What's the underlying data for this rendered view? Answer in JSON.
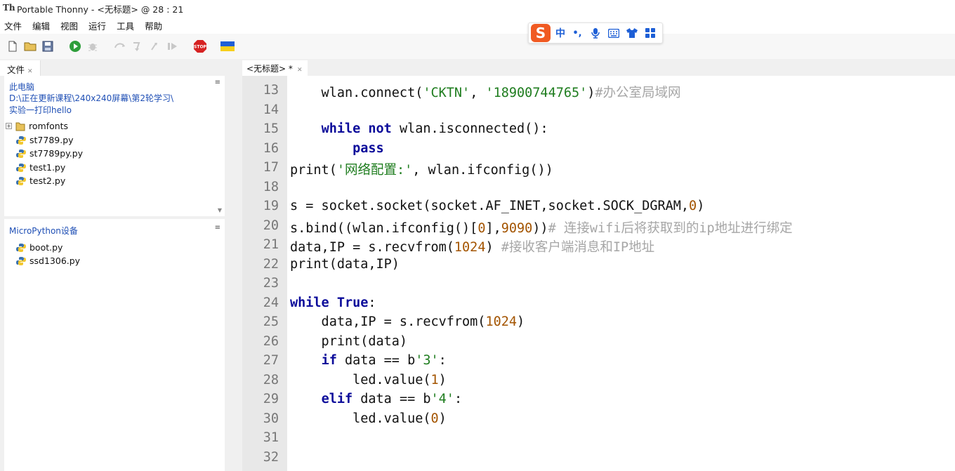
{
  "window": {
    "title": "Portable Thonny  -  <无标题>  @  28 : 21"
  },
  "menu": [
    "文件",
    "编辑",
    "视图",
    "运行",
    "工具",
    "帮助"
  ],
  "ime": {
    "logo": "S",
    "lang": "中",
    "punct": "•,"
  },
  "files_pane": {
    "tab_label": "文件",
    "location_label": "此电脑",
    "path_lines": [
      "D:\\正在更新课程\\240x240屏幕\\第2轮学习\\",
      "实验一打印hello"
    ],
    "folders": [
      "romfonts"
    ],
    "files": [
      "st7789.py",
      "st7789py.py",
      "test1.py",
      "test2.py"
    ]
  },
  "device_pane": {
    "label": "MicroPython设备",
    "files": [
      "boot.py",
      "ssd1306.py"
    ]
  },
  "editor": {
    "tab_label": "<无标题> *",
    "lines": [
      {
        "n": "13",
        "tokens": [
          {
            "t": "    wlan.connect("
          },
          {
            "t": "'CKTN'",
            "c": "str"
          },
          {
            "t": ", "
          },
          {
            "t": "'18900744765'",
            "c": "str"
          },
          {
            "t": ")"
          },
          {
            "t": "#办公室局域网",
            "c": "cmt"
          }
        ]
      },
      {
        "n": "14",
        "tokens": []
      },
      {
        "n": "15",
        "tokens": [
          {
            "t": "    "
          },
          {
            "t": "while",
            "c": "kw"
          },
          {
            "t": " "
          },
          {
            "t": "not",
            "c": "kw"
          },
          {
            "t": " wlan.isconnected():"
          }
        ]
      },
      {
        "n": "16",
        "tokens": [
          {
            "t": "        "
          },
          {
            "t": "pass",
            "c": "kw"
          }
        ]
      },
      {
        "n": "17",
        "tokens": [
          {
            "t": "print("
          },
          {
            "t": "'网络配置:'",
            "c": "str"
          },
          {
            "t": ", wlan.ifconfig())"
          }
        ]
      },
      {
        "n": "18",
        "tokens": []
      },
      {
        "n": "19",
        "tokens": [
          {
            "t": "s = socket.socket(socket.AF_INET,socket.SOCK_DGRAM,"
          },
          {
            "t": "0",
            "c": "num"
          },
          {
            "t": ")"
          }
        ]
      },
      {
        "n": "20",
        "tokens": [
          {
            "t": "s.bind((wlan.ifconfig()["
          },
          {
            "t": "0",
            "c": "num"
          },
          {
            "t": "],"
          },
          {
            "t": "9090",
            "c": "num"
          },
          {
            "t": "))"
          },
          {
            "t": "# 连接wifi后将获取到的ip地址进行绑定",
            "c": "cmt"
          }
        ]
      },
      {
        "n": "21",
        "tokens": [
          {
            "t": "data,IP = s.recvfrom("
          },
          {
            "t": "1024",
            "c": "num"
          },
          {
            "t": ") "
          },
          {
            "t": "#接收客户端消息和IP地址",
            "c": "cmt"
          }
        ]
      },
      {
        "n": "22",
        "tokens": [
          {
            "t": "print(data,IP)"
          }
        ]
      },
      {
        "n": "23",
        "tokens": []
      },
      {
        "n": "24",
        "tokens": [
          {
            "t": "while",
            "c": "kw"
          },
          {
            "t": " "
          },
          {
            "t": "True",
            "c": "kw"
          },
          {
            "t": ":"
          }
        ]
      },
      {
        "n": "25",
        "tokens": [
          {
            "t": "    data,IP = s.recvfrom("
          },
          {
            "t": "1024",
            "c": "num"
          },
          {
            "t": ")"
          }
        ]
      },
      {
        "n": "26",
        "tokens": [
          {
            "t": "    print(data)"
          }
        ]
      },
      {
        "n": "27",
        "tokens": [
          {
            "t": "    "
          },
          {
            "t": "if",
            "c": "kw"
          },
          {
            "t": " data == b"
          },
          {
            "t": "'3'",
            "c": "str"
          },
          {
            "t": ":"
          }
        ]
      },
      {
        "n": "28",
        "tokens": [
          {
            "t": "        led.value("
          },
          {
            "t": "1",
            "c": "num"
          },
          {
            "t": ")"
          }
        ]
      },
      {
        "n": "29",
        "tokens": [
          {
            "t": "    "
          },
          {
            "t": "elif",
            "c": "kw"
          },
          {
            "t": " data == b"
          },
          {
            "t": "'4'",
            "c": "str"
          },
          {
            "t": ":"
          }
        ]
      },
      {
        "n": "30",
        "tokens": [
          {
            "t": "        led.value("
          },
          {
            "t": "0",
            "c": "num"
          },
          {
            "t": ")"
          }
        ]
      },
      {
        "n": "31",
        "tokens": []
      },
      {
        "n": "32",
        "tokens": []
      }
    ]
  }
}
